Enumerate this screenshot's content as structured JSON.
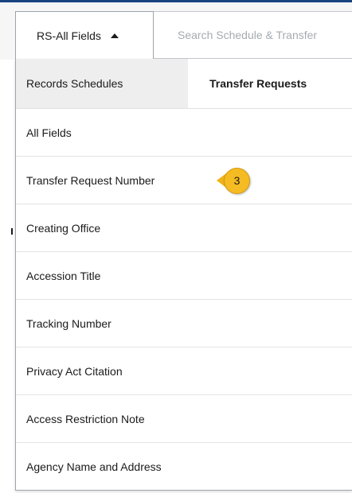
{
  "field_select": {
    "label": "RS-All Fields"
  },
  "search": {
    "placeholder": "Search Schedule & Transfer"
  },
  "dropdown": {
    "tabs": [
      {
        "label": "Records Schedules",
        "active": false
      },
      {
        "label": "Transfer Requests",
        "active": true
      }
    ],
    "options": [
      "All Fields",
      "Transfer Request Number",
      "Creating Office",
      "Accession Title",
      "Tracking Number",
      "Privacy Act Citation",
      "Access Restriction Note",
      "Agency Name and Address"
    ]
  },
  "callout": {
    "number": "3",
    "color": "#f5bb22"
  },
  "colors": {
    "accent": "#1a4480",
    "callout": "#f5bb22"
  }
}
